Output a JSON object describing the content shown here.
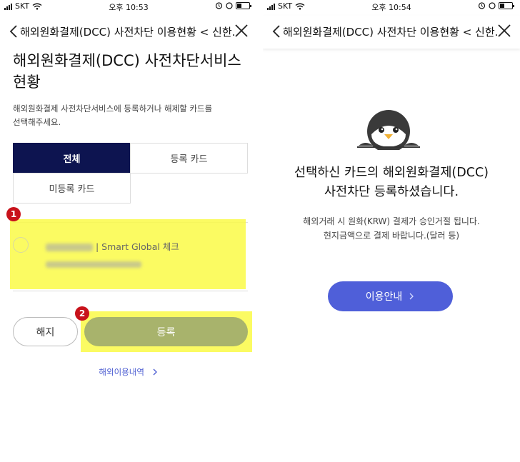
{
  "status_bar": {
    "carrier": "SKT",
    "left_time": "오후 10:53",
    "right_time": "오후 10:54"
  },
  "header": {
    "title": "해외원화결제(DCC) 사전차단 이용현황 < 신한..."
  },
  "left_screen": {
    "page_title_line1": "해외원화결제(DCC) 사전차단서비스",
    "page_title_line2": "현황",
    "description_line1": "해외원화결제 사전차단서비스에 등록하거나 해제할 카드를",
    "description_line2": "선택해주세요.",
    "tabs": [
      {
        "label": "전체",
        "active": true
      },
      {
        "label": "등록 카드",
        "active": false
      },
      {
        "label": "미등록 카드",
        "active": false
      }
    ],
    "card": {
      "name_suffix": "| Smart Global 체크"
    },
    "markers": [
      "1",
      "2"
    ],
    "cancel_label": "해지",
    "register_label": "등록",
    "history_link": "해외이용내역"
  },
  "right_screen": {
    "title_line1": "선택하신 카드의 해외원화결제(DCC)",
    "title_line2": "사전차단 등록하셨습니다.",
    "desc_line1": "해외거래 시 원화(KRW) 결제가 승인거절 됩니다.",
    "desc_line2": "현지금액으로 결제 바랍니다.(달러 등)",
    "guide_button": "이용안내"
  },
  "colors": {
    "navy": "#0d1450",
    "highlight": "#fafa46",
    "marker": "#c8121b",
    "register_button": "#a8b36c",
    "guide_button": "#4f5fd9",
    "link": "#4a5bd1"
  },
  "icons": [
    "back-chevron-icon",
    "close-icon",
    "wifi-icon",
    "alarm-icon",
    "battery-icon",
    "penguin-illustration",
    "chevron-right-icon"
  ]
}
